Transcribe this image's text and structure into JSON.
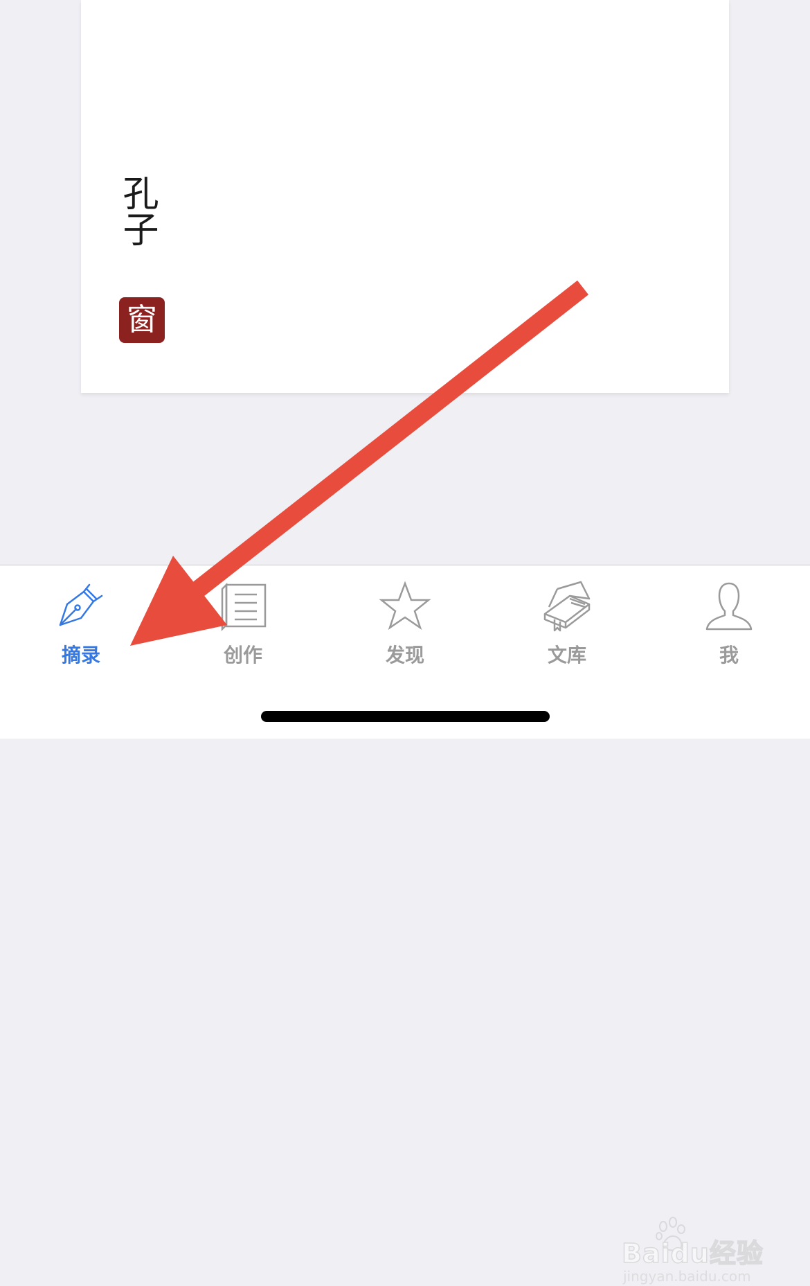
{
  "quote_card": {
    "author": "孔子",
    "seal_text": "窗"
  },
  "tab_bar": {
    "tabs": [
      {
        "label": "摘录",
        "icon": "fountain-pen-icon",
        "active": true
      },
      {
        "label": "创作",
        "icon": "document-icon",
        "active": false
      },
      {
        "label": "发现",
        "icon": "star-icon",
        "active": false
      },
      {
        "label": "文库",
        "icon": "book-icon",
        "active": false
      },
      {
        "label": "我",
        "icon": "person-icon",
        "active": false
      }
    ]
  },
  "colors": {
    "accent": "#3478e5",
    "inactive": "#9a9a9a",
    "seal": "#8b2220",
    "annotation_arrow": "#e84c3d"
  },
  "watermark": {
    "brand": "Baidu经验",
    "url": "jingyan.baidu.com"
  }
}
